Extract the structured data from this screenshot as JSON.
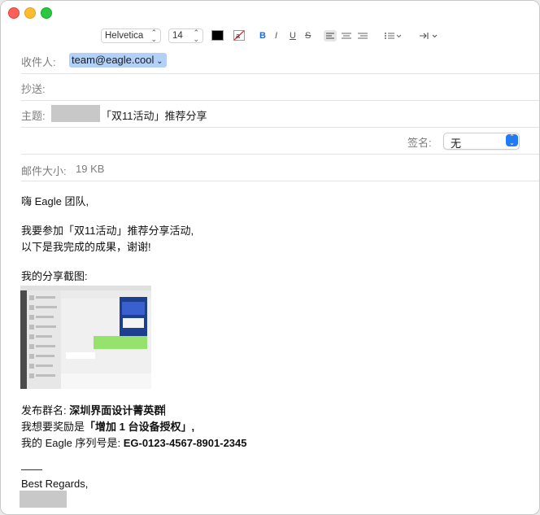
{
  "toolbar": {
    "font_name": "Helvetica",
    "font_size": "14",
    "bold": "B",
    "italic": "I",
    "underline": "U",
    "strike": "S"
  },
  "header": {
    "to_label": "收件人:",
    "to_value": "team@eagle.cool",
    "cc_label": "抄送:",
    "subject_label": "主题:",
    "subject_text": "「双11活动」推荐分享",
    "signature_label": "签名:",
    "signature_value": "无",
    "size_label": "邮件大小:",
    "size_value": "19 KB"
  },
  "body": {
    "greeting": "嗨 Eagle 团队,",
    "line1": "我要参加「双11活动」推荐分享活动,",
    "line2": "以下是我完成的成果，谢谢!",
    "screenshot_label": "我的分享截图:",
    "group_label": "发布群名:",
    "group_value": "深圳界面设计菁英群",
    "reward_label": "我想要奖励是",
    "reward_value": "「增加 1 台设备授权」,",
    "serial_label": "我的 Eagle 序列号是:",
    "serial_value": "EG-0123-4567-8901-2345",
    "dash": "——",
    "regards": "Best Regards,"
  }
}
